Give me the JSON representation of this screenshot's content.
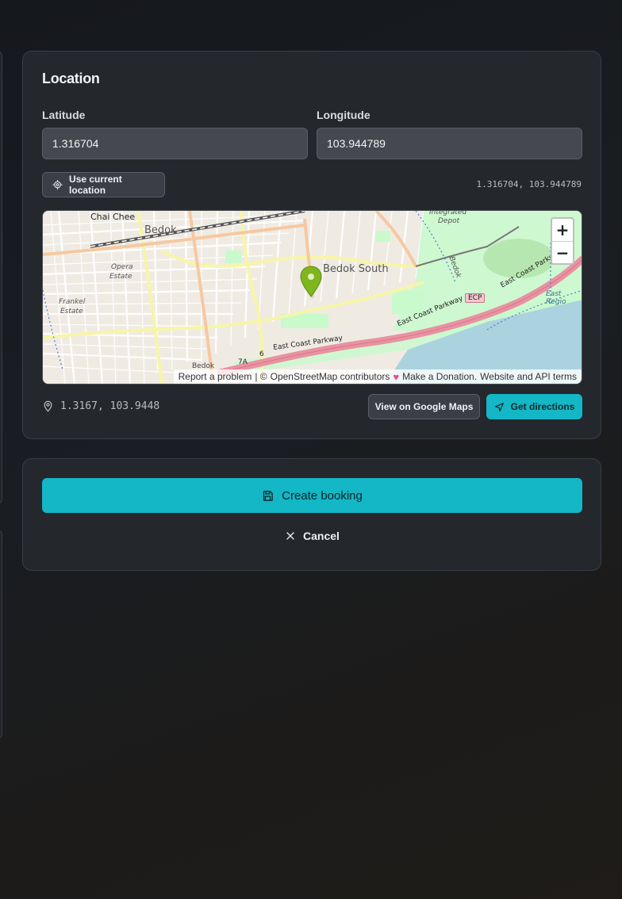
{
  "location": {
    "title": "Location",
    "latitude_label": "Latitude",
    "longitude_label": "Longitude",
    "latitude_value": "1.316704",
    "longitude_value": "103.944789",
    "use_current_location_label": "Use current location",
    "coords_readout": "1.316704, 103.944789",
    "pin_coords": "1.3167, 103.9448",
    "view_google_maps_label": "View on Google Maps",
    "get_directions_label": "Get directions"
  },
  "map": {
    "place_labels": {
      "chai_chee": "Chai Chee",
      "bedok": "Bedok",
      "bedok_south": "Bedok South",
      "opera_estate_1": "Opera",
      "opera_estate_2": "Estate",
      "frankel_1": "Frankel",
      "frankel_2": "Estate",
      "integrated_depot_1": "Integrated",
      "integrated_depot_2": "Depot",
      "east_coast_parkway_a": "East Coast Parkway",
      "east_coast_parkway_b": "East Coast Parkway",
      "east_coast_parkway_c": "East Coast Parkway",
      "ecp_badge": "ECP",
      "bedok_rail": "Bedok",
      "east_region": "East Regio",
      "road_6": "6",
      "road_7a": "7A",
      "bedok_small": "Bedok"
    },
    "zoom_in": "+",
    "zoom_out": "−",
    "attribution": {
      "report": "Report a problem",
      "separator": "| ©",
      "osm": "OpenStreetMap contributors",
      "donation": "Make a Donation.",
      "website": "Website and API terms"
    },
    "colors": {
      "water": "#aad3df",
      "park": "#c8facc",
      "road_major": "#f7c8a0",
      "highway": "#e892a2",
      "marker": "#7fb51f"
    }
  },
  "actions": {
    "create_label": "Create booking",
    "cancel_label": "Cancel"
  },
  "colors": {
    "accent": "#13b7c5"
  }
}
